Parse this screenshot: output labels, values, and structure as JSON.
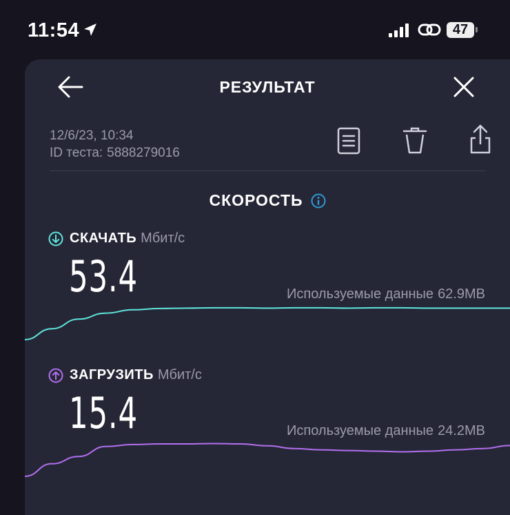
{
  "status_bar": {
    "time": "11:54",
    "battery": "47"
  },
  "header": {
    "title": "РЕЗУЛЬТАТ"
  },
  "meta": {
    "datetime": "12/6/23, 10:34",
    "id_label": "ID теста:",
    "id_value": "5888279016"
  },
  "section": {
    "title": "СКОРОСТЬ"
  },
  "download": {
    "label": "СКАЧАТЬ",
    "unit": "Мбит/с",
    "value": "53.4",
    "data_label": "Используемые данные",
    "data_value": "62.9MB",
    "color": "#5ee6dc",
    "curve": [
      0.0,
      0.33,
      0.62,
      0.8,
      0.9,
      0.94,
      0.95,
      0.96,
      0.96,
      0.95,
      0.96,
      0.96,
      0.95,
      0.96,
      0.96,
      0.95,
      0.95,
      0.95,
      0.95
    ]
  },
  "upload": {
    "label": "ЗАГРУЗИТЬ",
    "unit": "Мбит/с",
    "value": "15.4",
    "data_label": "Используемые данные",
    "data_value": "24.2MB",
    "color": "#b26ff0",
    "curve": [
      0.0,
      0.38,
      0.6,
      0.9,
      0.96,
      0.98,
      0.98,
      0.99,
      0.98,
      0.92,
      0.84,
      0.8,
      0.78,
      0.76,
      0.74,
      0.76,
      0.8,
      0.84,
      0.93
    ]
  },
  "colors": {
    "background": "#15141f",
    "card": "#262736",
    "accent_info": "#2e9bd6"
  }
}
